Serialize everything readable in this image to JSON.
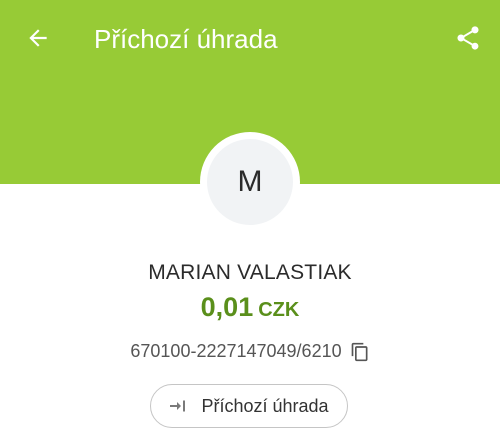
{
  "app": {
    "title": "Příchozí úhrada",
    "accent_color": "#97cb36",
    "amount_color": "#5a8f1b"
  },
  "toolbar": {
    "back_icon": "arrow-left-icon",
    "share_icon": "share-icon"
  },
  "counterparty": {
    "avatar_initial": "M",
    "name": "MARIAN VALASTIAK",
    "account": "670100-2227147049/6210",
    "copy_icon": "copy-icon"
  },
  "transaction": {
    "amount": "0,01",
    "currency": "CZK",
    "type_label": "Příchozí úhrada",
    "type_icon": "incoming-arrow-icon"
  }
}
